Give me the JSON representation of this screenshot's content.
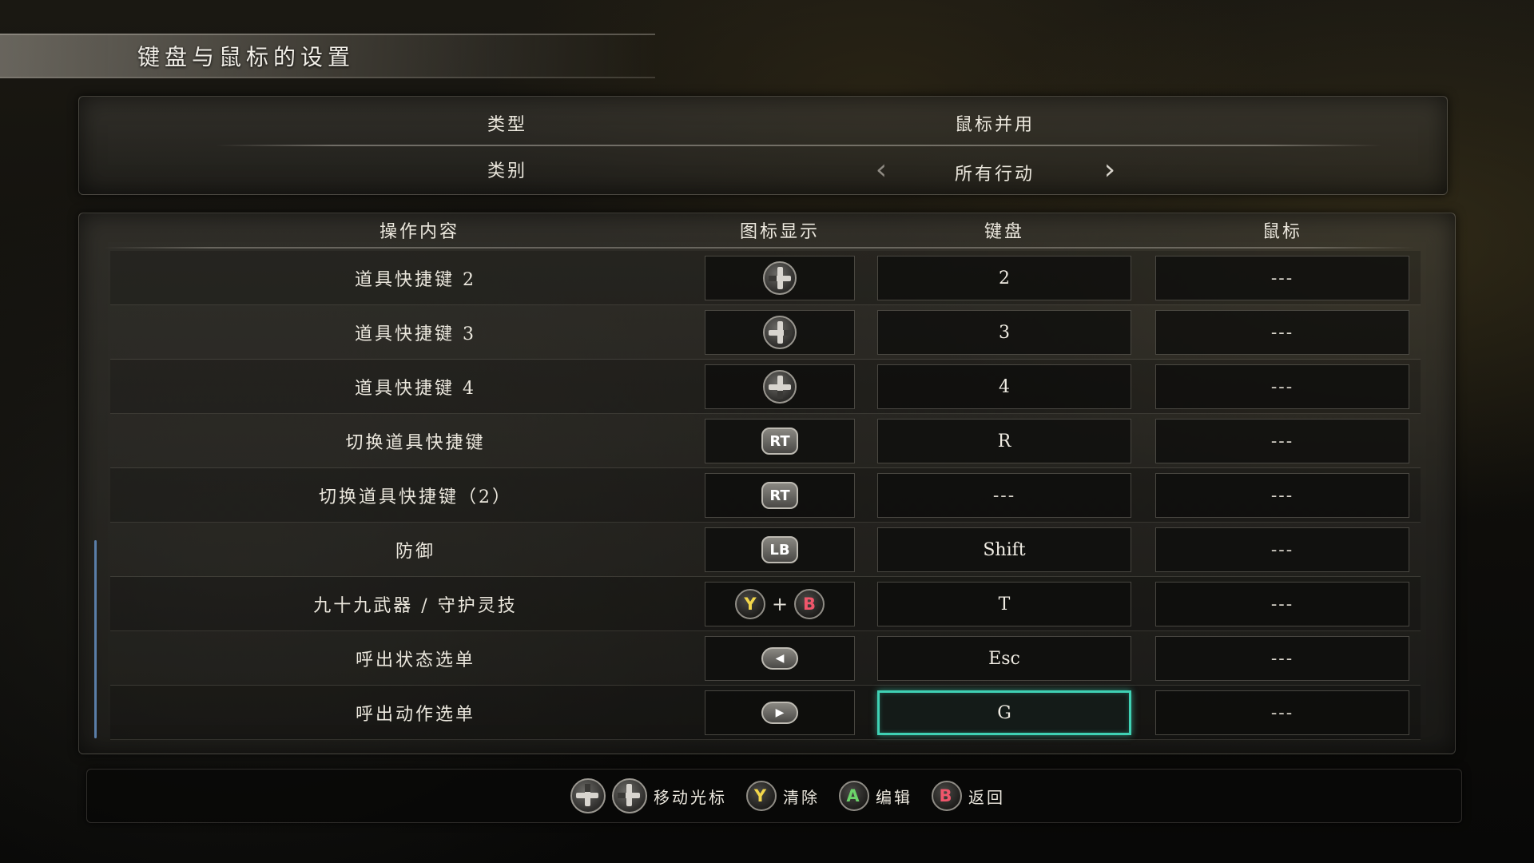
{
  "page": {
    "title": "键盘与鼠标的设置"
  },
  "settings": {
    "type_label": "类型",
    "type_value": "鼠标并用",
    "category_label": "类别",
    "category_value": "所有行动"
  },
  "table": {
    "headers": {
      "action": "操作内容",
      "icon": "图标显示",
      "keyboard": "键盘",
      "mouse": "鼠标"
    },
    "rows": [
      {
        "action": "道具快捷键 2",
        "icon": "dpad-left-icon",
        "keyboard": "2",
        "mouse": "---"
      },
      {
        "action": "道具快捷键 3",
        "icon": "dpad-right-icon",
        "keyboard": "3",
        "mouse": "---"
      },
      {
        "action": "道具快捷键 4",
        "icon": "dpad-down-icon",
        "keyboard": "4",
        "mouse": "---"
      },
      {
        "action": "切换道具快捷键",
        "icon": "rt-button-icon",
        "icon_text": "RT",
        "keyboard": "R",
        "mouse": "---"
      },
      {
        "action": "切换道具快捷键（2）",
        "icon": "rt-button-icon",
        "icon_text": "RT",
        "keyboard": "---",
        "mouse": "---"
      },
      {
        "action": "防御",
        "icon": "lb-button-icon",
        "icon_text": "LB",
        "keyboard": "Shift",
        "mouse": "---"
      },
      {
        "action": "九十九武器 / 守护灵技",
        "icon": "y-plus-b-combo-icon",
        "icon_y": "Y",
        "icon_plus": "+",
        "icon_b": "B",
        "keyboard": "T",
        "mouse": "---"
      },
      {
        "action": "呼出状态选单",
        "icon": "view-button-icon",
        "icon_text": "◀",
        "keyboard": "Esc",
        "mouse": "---"
      },
      {
        "action": "呼出动作选单",
        "icon": "menu-button-icon",
        "icon_text": "▶",
        "keyboard": "G",
        "mouse": "---",
        "selected": true
      }
    ]
  },
  "footer": {
    "move_cursor": "移动光标",
    "y_key": "Y",
    "clear": "清除",
    "a_key": "A",
    "edit": "编辑",
    "b_key": "B",
    "back": "返回"
  },
  "colors": {
    "selection": "#3fd1b4",
    "button_y": "#f2d64a",
    "button_b": "#f0566b",
    "button_a": "#6cd36a",
    "scroll": "#5a7ea8"
  }
}
